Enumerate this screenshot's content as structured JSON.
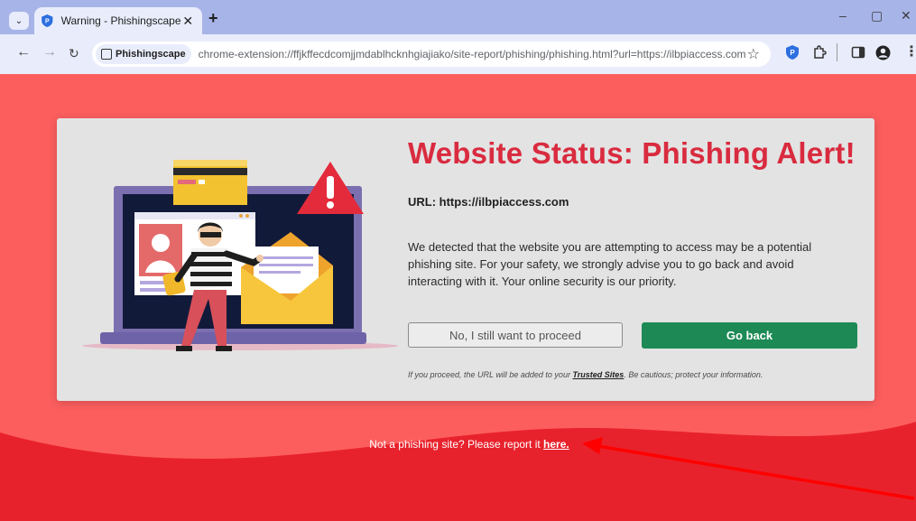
{
  "browser": {
    "tab_title": "Warning - Phishingscape",
    "site_chip": "Phishingscape",
    "url": "chrome-extension://ffjkffecdcomjjmdablhcknhgiajiako/site-report/phishing/phishing.html?url=https://ilbpiaccess.com",
    "accent_color": "#a7b4e8"
  },
  "warning": {
    "title": "Website Status: Phishing Alert!",
    "url_line": "URL: https://ilbpiaccess.com",
    "description": "We detected that the website you are attempting to access may be a potential phishing site. For your safety, we strongly advise you to go back and avoid interacting with it. Your online security is our priority.",
    "proceed_label": "No, I still want to proceed",
    "back_label": "Go back",
    "note_prefix": "If you proceed, the URL will be added to your ",
    "note_link": "Trusted Sites",
    "note_suffix": ". Be cautious; protect your information.",
    "title_color": "#d92b3f",
    "back_color": "#1d8a55"
  },
  "footer": {
    "report_text": "Not a phishing site? Please report it ",
    "report_link": "here."
  },
  "page_colors": {
    "background": "#fc5e5e",
    "wave": "#e8222c"
  }
}
